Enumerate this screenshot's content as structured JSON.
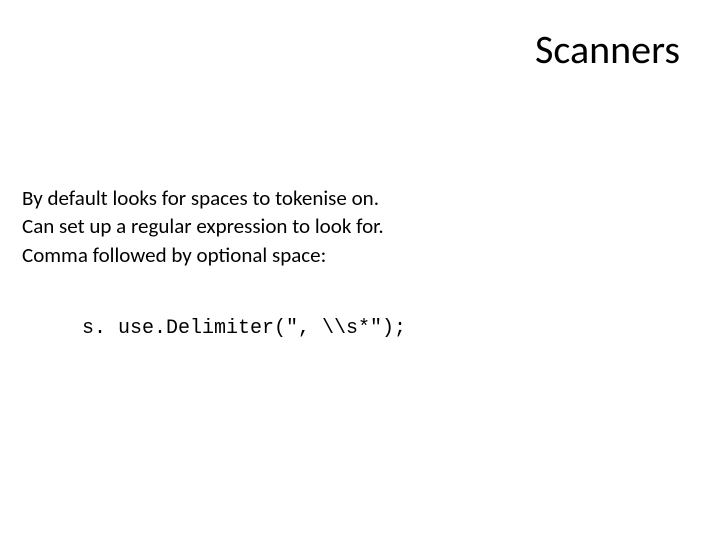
{
  "title": "Scanners",
  "body": {
    "line1": "By default looks for spaces to tokenise on.",
    "line2": "Can set up a regular expression to look for.",
    "line3": "Comma followed by optional space:"
  },
  "code": "s. use.Delimiter(\", \\\\s*\");"
}
